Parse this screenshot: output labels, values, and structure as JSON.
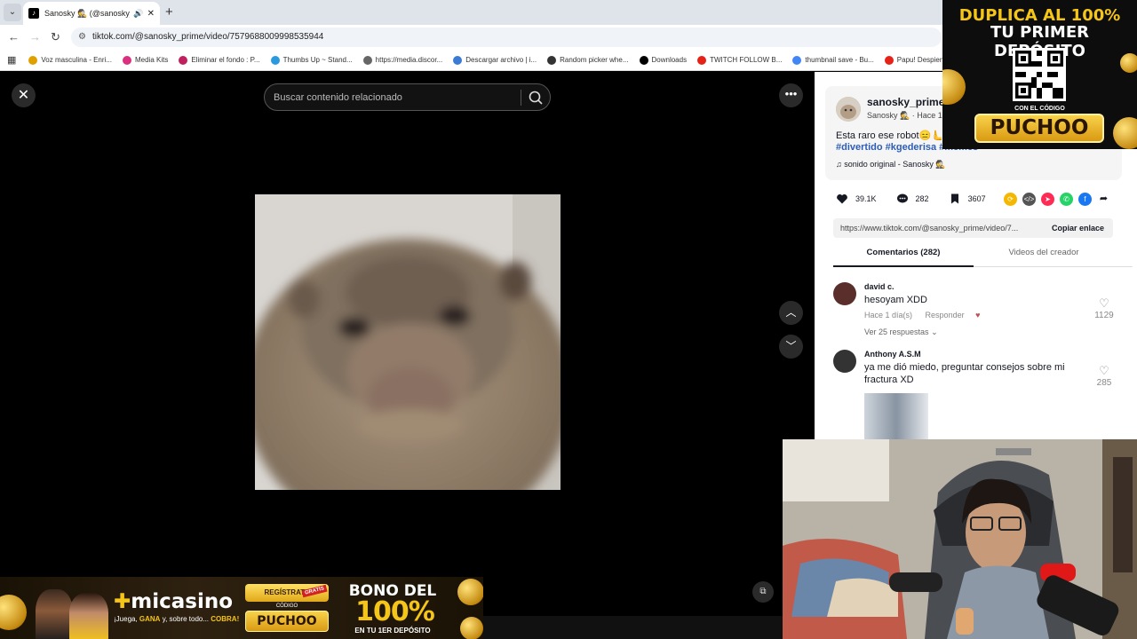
{
  "browser": {
    "tab_title": "Sanosky 🕵️ (@sanosky_prim",
    "url": "tiktok.com/@sanosky_prime/video/7579688009998535944",
    "bookmarks": [
      {
        "label": "Voz masculina - Enri...",
        "color": "#e0a000"
      },
      {
        "label": "Media Kits",
        "color": "#d93080"
      },
      {
        "label": "Eliminar el fondo : P...",
        "color": "#c02060"
      },
      {
        "label": "Thumbs Up ~ Stand...",
        "color": "#2a9adf"
      },
      {
        "label": "https://media.discor...",
        "color": "#666666"
      },
      {
        "label": "Descargar archivo | i...",
        "color": "#3b7bd4"
      },
      {
        "label": "Random picker whe...",
        "color": "#333333"
      },
      {
        "label": "Downloads",
        "color": "#000000"
      },
      {
        "label": "TWITCH FOLLOW B...",
        "color": "#e62117"
      },
      {
        "label": "thumbnail save - Bu...",
        "color": "#4285f4"
      },
      {
        "label": "Papu! Despierta!",
        "color": "#e62117"
      }
    ]
  },
  "video": {
    "search_placeholder": "Buscar contenido relacionado"
  },
  "post": {
    "author": "sanosky_prime",
    "author_sub": "Sanosky 🕵️ · Hace 1",
    "description": "Esta raro ese robot😑🫷",
    "tags": "#divertido #kgederisa #memes",
    "music": "sonido original - Sanosky 🕵️",
    "likes": "39.1K",
    "comments": "282",
    "saves": "3607",
    "link": "https://www.tiktok.com/@sanosky_prime/video/7...",
    "copy_label": "Copiar enlace",
    "tab_comments": "Comentarios (282)",
    "tab_videos": "Videos del creador"
  },
  "comments": [
    {
      "user": "david c.",
      "text": "hesoyam XDD",
      "meta": "Hace 1 día(s)",
      "reply": "Responder",
      "replies": "Ver 25 respuestas",
      "likes": "1129"
    },
    {
      "user": "Anthony A.S.M",
      "text": "ya me dió miedo, preguntar consejos sobre mi fractura XD",
      "likes": "285"
    }
  ],
  "ad_top": {
    "line1": "DUPLICA AL 100%",
    "line2": "TU PRIMER DEPÓSITO",
    "line3": "CON EL CÓDIGO",
    "code": "PUCHOO"
  },
  "ad_bottom": {
    "brand": "micasino",
    "tagline_1": "¡Juega, ",
    "tagline_bold": "GANA",
    "tagline_2": " y, sobre todo... ",
    "tagline_end": "COBRA!",
    "register": "REGÍSTRATE",
    "free": "GRATIS",
    "code_label": "CÓDIGO",
    "code": "PUCHOO",
    "bono_1": "BONO DEL",
    "bono_2": "100%",
    "bono_3": "EN TU 1ER DEPÓSITO"
  }
}
